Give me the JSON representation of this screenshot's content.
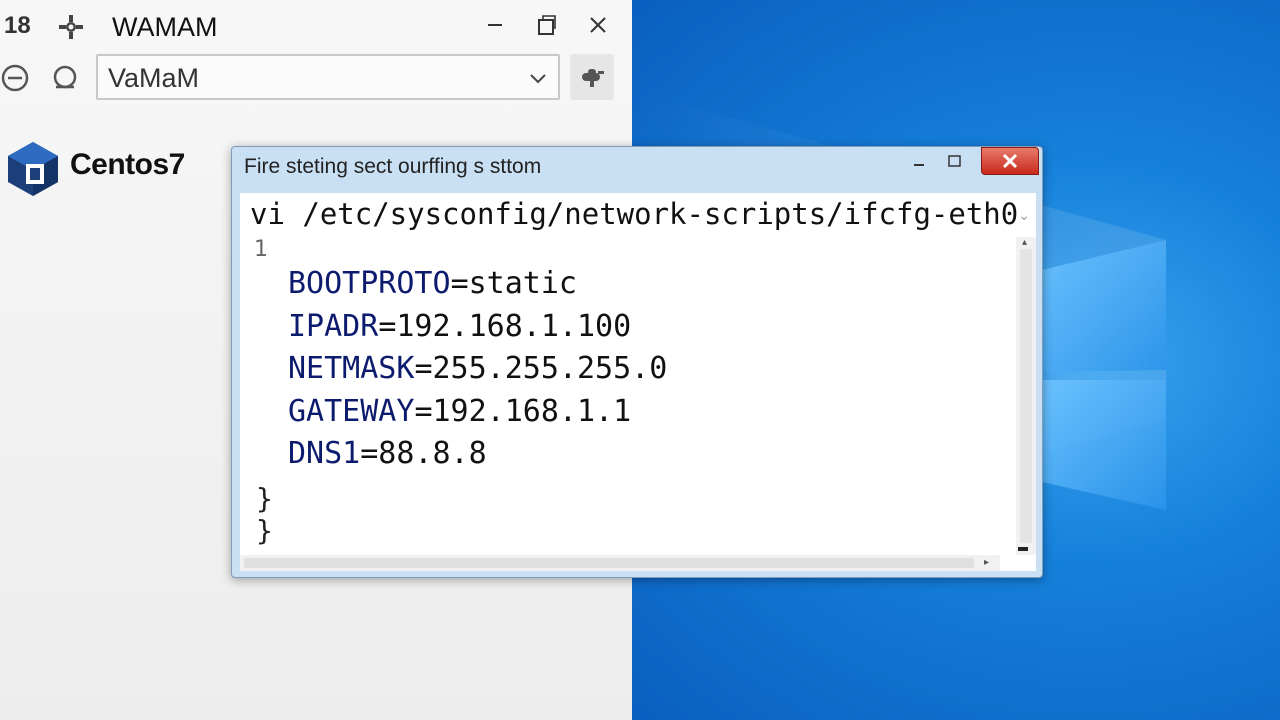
{
  "app": {
    "number": "18",
    "title": "WAMAM",
    "combo_value": "VaMaM",
    "brand": "Centos7",
    "icons": {
      "app_icon": "settings-gear-icon",
      "back": "back-circle-icon",
      "refresh": "refresh-icon",
      "tool": "cloud-tool-icon"
    }
  },
  "dialog": {
    "title": "Fire steting sect ourffing s sttom",
    "command": "vi /etc/sysconfig/network-scripts/ifcfg-eth0",
    "line_number": "1",
    "lines": [
      {
        "key": "BOOTPROTO",
        "value": "=static"
      },
      {
        "key": "IPADR",
        "value": "=192.168.1.100"
      },
      {
        "key": "NETMASK",
        "value": "=255.255.255.0"
      },
      {
        "key": "GATEWAY",
        "value": "=192.168.1.1"
      },
      {
        "key": "DNS1",
        "value": "=88.8.8"
      }
    ],
    "brace1": "}",
    "brace2": "}"
  },
  "colors": {
    "desktop": "#1580da",
    "close_button": "#c7291c",
    "code_key": "#0d1b6e"
  }
}
